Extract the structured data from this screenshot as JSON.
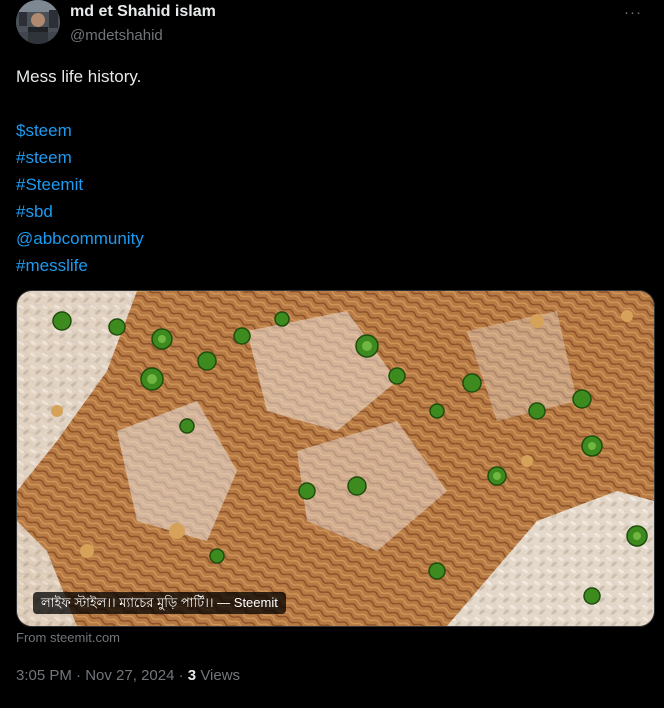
{
  "author": {
    "display_name": "md et Shahid islam",
    "handle": "@mdetshahid",
    "avatar_icon": "profile-photo"
  },
  "more_icon": "more-horizontal-icon",
  "more_label": "···",
  "tweet": {
    "text": "Mess life history.",
    "tags": [
      "$steem",
      "#steem",
      "#Steemit",
      "#sbd",
      "@abbcommunity",
      "#messlife"
    ]
  },
  "media": {
    "caption": "লাইফ স্টাইল।। ম্যাচের মুড়ি পার্টি।। — Steemit",
    "source": "From steemit.com"
  },
  "meta": {
    "time": "3:05 PM",
    "separator": "·",
    "date": "Nov 27, 2024",
    "views_count": "3",
    "views_label": "Views"
  },
  "colors": {
    "background": "#000000",
    "text": "#e7e9ea",
    "secondary": "#71767b",
    "link": "#1d9bf0"
  }
}
